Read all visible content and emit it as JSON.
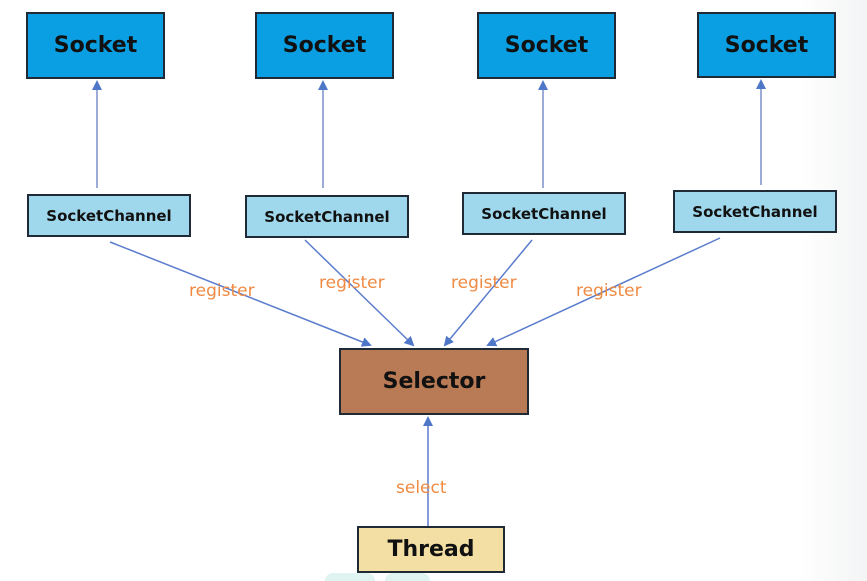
{
  "diagram": {
    "sockets": [
      {
        "label": "Socket"
      },
      {
        "label": "Socket"
      },
      {
        "label": "Socket"
      },
      {
        "label": "Socket"
      }
    ],
    "channels": [
      {
        "label": "SocketChannel"
      },
      {
        "label": "SocketChannel"
      },
      {
        "label": "SocketChannel"
      },
      {
        "label": "SocketChannel"
      }
    ],
    "register_labels": [
      "register",
      "register",
      "register",
      "register"
    ],
    "selector": {
      "label": "Selector"
    },
    "thread": {
      "label": "Thread"
    },
    "select_label": "select",
    "colors": {
      "socket": "#0a9ee2",
      "channel": "#9fd8ec",
      "selector": "#b97a56",
      "thread": "#f3dfa4",
      "arrow": "#5a7ccc",
      "label": "#ef8a43"
    }
  }
}
